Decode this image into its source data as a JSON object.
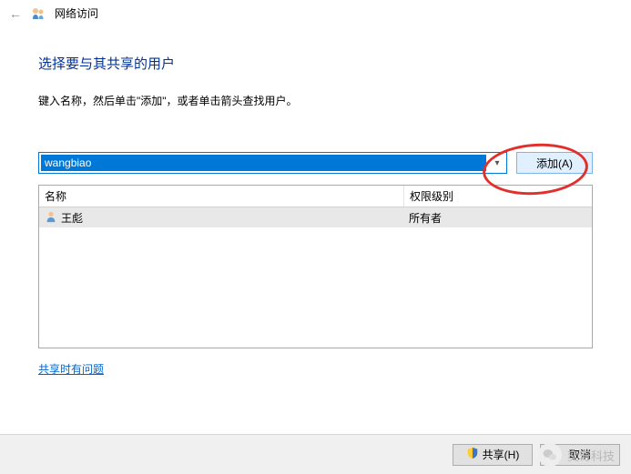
{
  "header": {
    "title": "网络访问"
  },
  "main": {
    "title": "选择要与其共享的用户",
    "instruction": "键入名称，然后单击\"添加\"，或者单击箭头查找用户。"
  },
  "input": {
    "value": "wangbiao",
    "add_button": "添加(A)"
  },
  "table": {
    "columns": {
      "name": "名称",
      "permission": "权限级别"
    },
    "rows": [
      {
        "name": "王彪",
        "permission": "所有者"
      }
    ]
  },
  "links": {
    "help": "共享时有问题"
  },
  "footer": {
    "share": "共享(H)",
    "cancel": "取消"
  },
  "watermark": {
    "text": "奕奇科技"
  }
}
